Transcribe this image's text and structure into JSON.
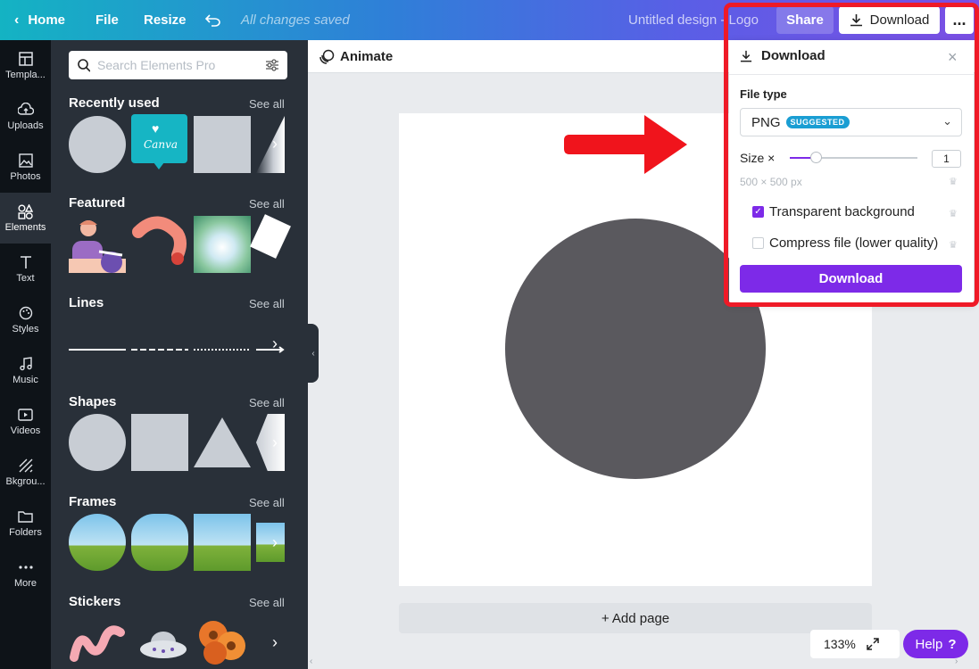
{
  "topbar": {
    "home_label": "Home",
    "file_label": "File",
    "resize_label": "Resize",
    "saved_status": "All changes saved",
    "design_title": "Untitled design - Logo",
    "share_label": "Share",
    "download_label": "Download",
    "more_label": "..."
  },
  "rail": {
    "items": [
      {
        "label": "Templa...",
        "icon": "template-icon"
      },
      {
        "label": "Uploads",
        "icon": "upload-cloud-icon"
      },
      {
        "label": "Photos",
        "icon": "photo-icon"
      },
      {
        "label": "Elements",
        "icon": "elements-icon"
      },
      {
        "label": "Text",
        "icon": "text-icon"
      },
      {
        "label": "Styles",
        "icon": "palette-icon"
      },
      {
        "label": "Music",
        "icon": "music-icon"
      },
      {
        "label": "Videos",
        "icon": "video-icon"
      },
      {
        "label": "Bkgrou...",
        "icon": "background-icon"
      },
      {
        "label": "Folders",
        "icon": "folder-icon"
      },
      {
        "label": "More",
        "icon": "more-dots-icon"
      }
    ]
  },
  "panel": {
    "search_placeholder": "Search Elements Pro",
    "see_all": "See all",
    "sections": {
      "recent": "Recently used",
      "featured": "Featured",
      "lines": "Lines",
      "shapes": "Shapes",
      "frames": "Frames",
      "stickers": "Stickers"
    },
    "canva_badge_text": "Canva"
  },
  "canvas": {
    "animate_label": "Animate",
    "add_page_label": "+ Add page",
    "zoom_label": "133%",
    "help_label": "Help",
    "help_icon": "?"
  },
  "download_panel": {
    "title": "Download",
    "close_icon": "×",
    "file_type_label": "File type",
    "file_type_value": "PNG",
    "suggested_badge": "SUGGESTED",
    "size_label": "Size ×",
    "size_value": "1",
    "size_slider_fraction": 0.2,
    "dimensions": "500 × 500 px",
    "transparent_label": "Transparent background",
    "transparent_checked": true,
    "compress_label": "Compress file (lower quality)",
    "compress_checked": false,
    "download_button": "Download"
  },
  "colors": {
    "accent_purple": "#7d2ae8",
    "highlight_red": "#ef1a27",
    "circle_fill": "#5a595e",
    "panel_bg": "#293039"
  }
}
